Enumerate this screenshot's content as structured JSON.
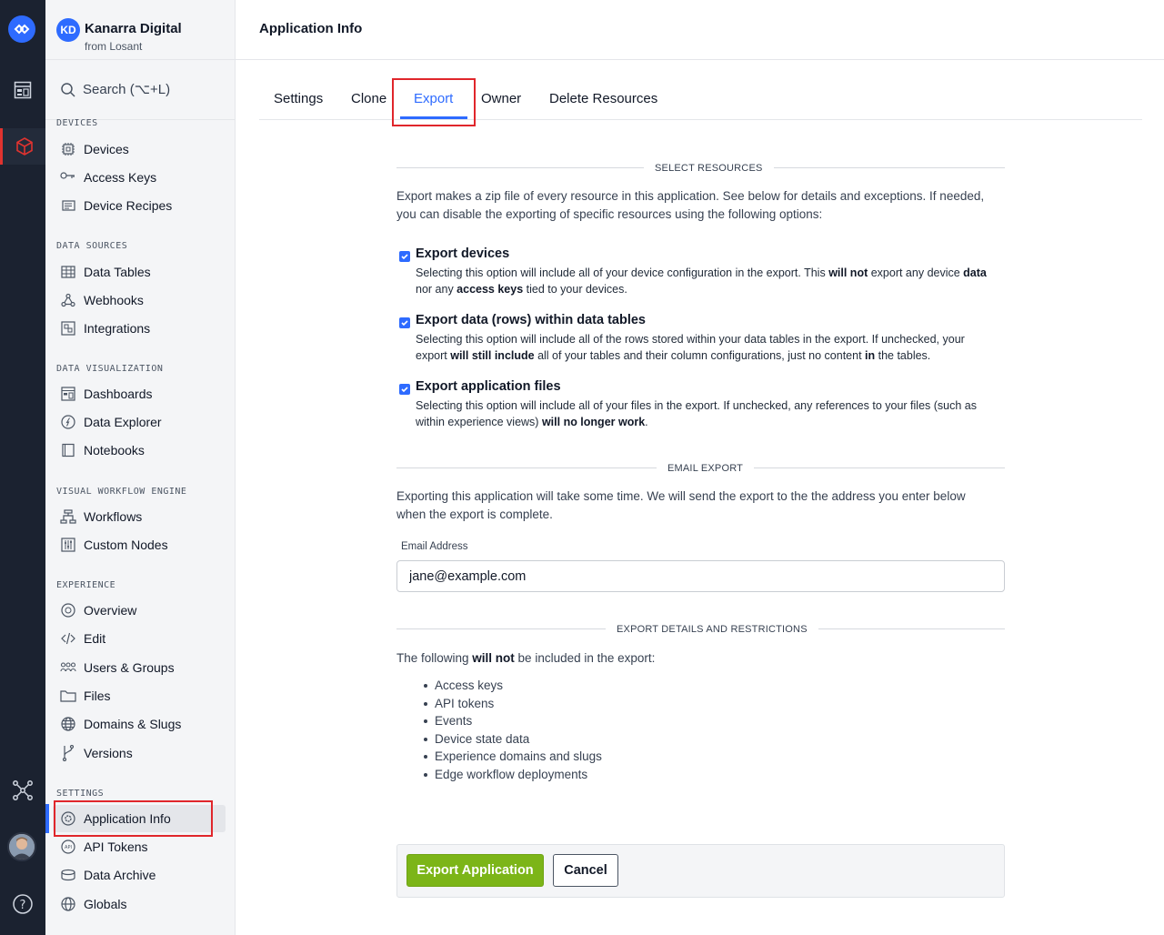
{
  "org": {
    "initials": "KD",
    "name": "Kanarra Digital",
    "subtitle": "from Losant"
  },
  "search": {
    "label": "Search (⌥+L)"
  },
  "sidebar": {
    "sections": {
      "devices": "DEVICES",
      "data_sources": "DATA SOURCES",
      "data_visualization": "DATA VISUALIZATION",
      "workflow_engine": "VISUAL WORKFLOW ENGINE",
      "experience": "EXPERIENCE",
      "settings": "SETTINGS"
    },
    "items": {
      "devices": "Devices",
      "access_keys": "Access Keys",
      "device_recipes": "Device Recipes",
      "data_tables": "Data Tables",
      "webhooks": "Webhooks",
      "integrations": "Integrations",
      "dashboards": "Dashboards",
      "data_explorer": "Data Explorer",
      "notebooks": "Notebooks",
      "workflows": "Workflows",
      "custom_nodes": "Custom Nodes",
      "overview": "Overview",
      "edit": "Edit",
      "users_groups": "Users & Groups",
      "files": "Files",
      "domains_slugs": "Domains & Slugs",
      "versions": "Versions",
      "application_info": "Application Info",
      "api_tokens": "API Tokens",
      "data_archive": "Data Archive",
      "globals": "Globals"
    }
  },
  "header": {
    "title": "Application Info"
  },
  "tabs": {
    "settings": "Settings",
    "clone": "Clone",
    "export": "Export",
    "owner": "Owner",
    "delete": "Delete Resources"
  },
  "select_resources": {
    "heading": "SELECT RESOURCES",
    "intro_1": "Export makes a zip file of every resource in this application. See below for details and exceptions. If needed,",
    "intro_2": "you can disable the exporting of specific resources using the following options:"
  },
  "options": {
    "devices": {
      "title": "Export devices",
      "d1a": "Selecting this option will include all of your device configuration in the export. This ",
      "d1b": "will not",
      "d1c": " export any device ",
      "d1d": "data",
      "d2a": "nor any ",
      "d2b": "access keys",
      "d2c": " tied to your devices."
    },
    "data_rows": {
      "title": "Export data (rows) within data tables",
      "d1": "Selecting this option will include all of the rows stored within your data tables in the export. If unchecked, your",
      "d2a": "export ",
      "d2b": "will still include",
      "d2c": " all of your tables and their column configurations, just no content ",
      "d2d": "in",
      "d2e": " the tables."
    },
    "files": {
      "title": "Export application files",
      "d1": "Selecting this option will include all of your files in the export. If unchecked, any references to your files (such as",
      "d2a": "within experience views) ",
      "d2b": "will no longer work",
      "d2c": "."
    }
  },
  "email_export": {
    "heading": "EMAIL EXPORT",
    "text_1": "Exporting this application will take some time. We will send the export to the the address you enter below",
    "text_2": "when the export is complete.",
    "field_label": "Email Address",
    "field_value": "jane@example.com"
  },
  "restrictions": {
    "heading": "EXPORT DETAILS AND RESTRICTIONS",
    "intro_a": "The following ",
    "intro_b": "will not",
    "intro_c": " be included in the export:",
    "items": [
      "Access keys",
      "API tokens",
      "Events",
      "Device state data",
      "Experience domains and slugs",
      "Edge workflow deployments"
    ]
  },
  "actions": {
    "export": "Export Application",
    "cancel": "Cancel"
  },
  "colors": {
    "accent": "#2e6bff",
    "primary_button": "#7cb518",
    "highlight": "#e0262b",
    "rail": "#1b2230"
  }
}
